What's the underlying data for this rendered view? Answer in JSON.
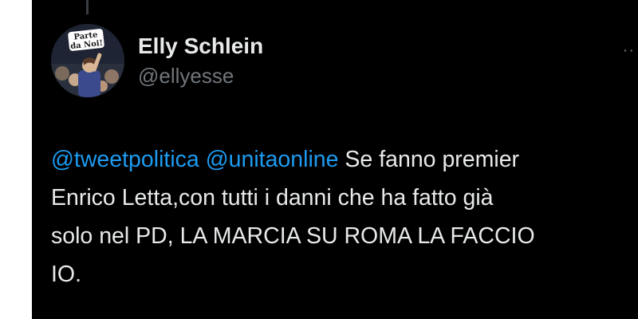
{
  "author": {
    "display_name": "Elly Schlein",
    "handle": "@ellyesse",
    "avatar_badge_lines": [
      "Parte",
      "da Noi!"
    ]
  },
  "tweet": {
    "mentions": [
      "@tweetpolitica",
      "@unitaonline"
    ],
    "lines": {
      "first_rest": "Se fanno premier",
      "second": "Enrico Letta,con tutti i danni che ha fatto già",
      "third": "solo nel PD, LA MARCIA SU ROMA LA FACCIO",
      "fourth": "IO."
    }
  },
  "colors": {
    "background": "#000000",
    "text": "#e7e9ea",
    "secondary": "#71767b",
    "link": "#1d9bf0"
  },
  "icons": {
    "more": "more-horizontal-icon"
  }
}
